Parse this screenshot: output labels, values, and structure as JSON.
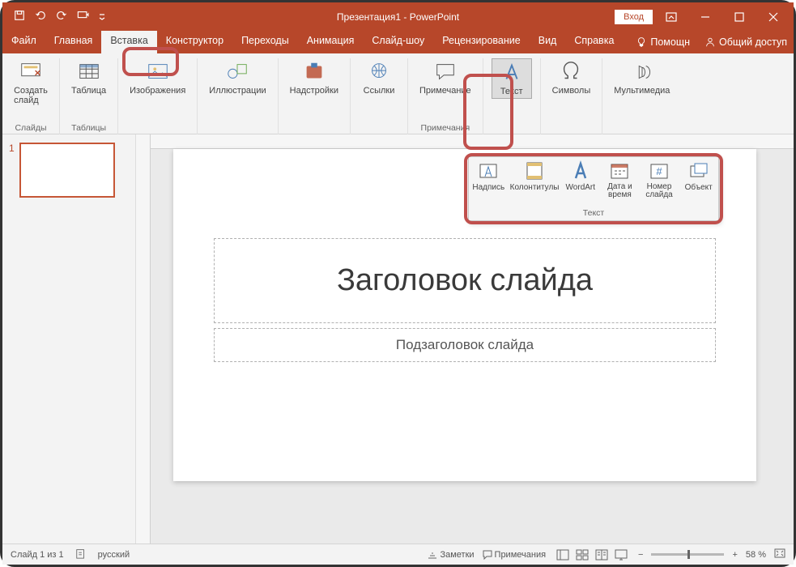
{
  "title": "Презентация1 - PowerPoint",
  "login": "Вход",
  "tabs": {
    "file": "Файл",
    "home": "Главная",
    "insert": "Вставка",
    "design": "Конструктор",
    "transitions": "Переходы",
    "animations": "Анимация",
    "slideshow": "Слайд-шоу",
    "review": "Рецензирование",
    "view": "Вид",
    "help": "Справка",
    "tellme": "Помощн",
    "share": "Общий доступ"
  },
  "ribbon": {
    "slides": {
      "newslide": "Создать\nслайд",
      "group": "Слайды"
    },
    "tables": {
      "table": "Таблица",
      "group": "Таблицы"
    },
    "images": {
      "images": "Изображения"
    },
    "illustrations": {
      "illustrations": "Иллюстрации"
    },
    "addins": {
      "addins": "Надстройки"
    },
    "links": {
      "links": "Ссылки"
    },
    "comments": {
      "comment": "Примечание",
      "group": "Примечания"
    },
    "text": {
      "text": "Текст"
    },
    "symbols": {
      "symbols": "Символы"
    },
    "media": {
      "media": "Мультимедиа"
    }
  },
  "flyout": {
    "textbox": "Надпись",
    "headerfooter": "Колонтитулы",
    "wordart": "WordArt",
    "datetime": "Дата и\nвремя",
    "slidenum": "Номер\nслайда",
    "object": "Объект",
    "group": "Текст"
  },
  "slide": {
    "num": "1",
    "title_ph": "Заголовок слайда",
    "subtitle_ph": "Подзаголовок слайда"
  },
  "status": {
    "slideinfo": "Слайд 1 из 1",
    "lang": "русский",
    "notes": "Заметки",
    "comments": "Примечания",
    "zoom": "58 %"
  }
}
